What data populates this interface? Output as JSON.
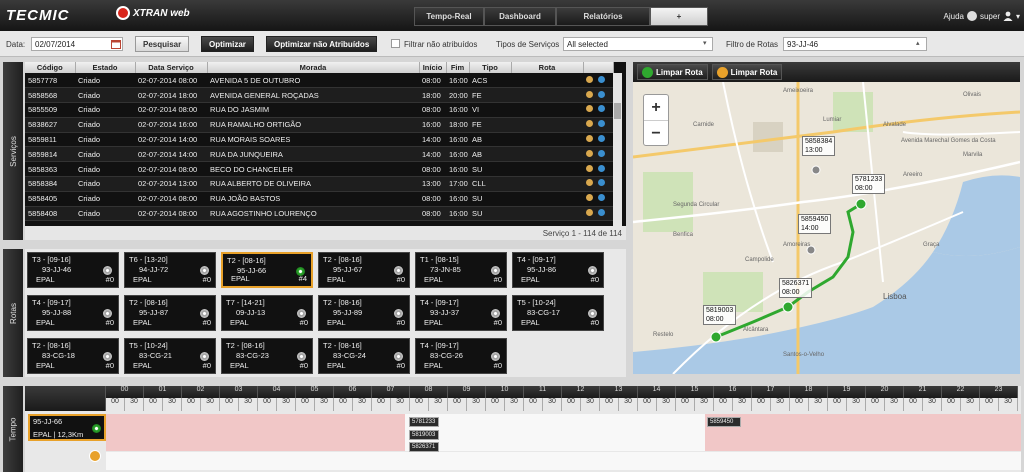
{
  "header": {
    "logo_primary": "TECMIC",
    "logo_secondary": "XTRAN web",
    "tabs": [
      "Tempo-Real",
      "Dashboard",
      "Relatórios",
      "+"
    ],
    "active_tab": 3,
    "help": "Ajuda",
    "user": "super"
  },
  "filters": {
    "date_label": "Data:",
    "date_value": "02/07/2014",
    "search_btn": "Pesquisar",
    "optimize_btn": "Optimizar",
    "optimize_unassigned_btn": "Optimizar não Atribuídos",
    "filter_unassigned_label": "Filtrar não atribuídos",
    "service_types_label": "Tipos de Serviços",
    "service_types_value": "All selected",
    "route_filter_label": "Filtro de Rotas",
    "route_filter_value": "93-JJ-46"
  },
  "services": {
    "panel_label": "Serviços",
    "columns": [
      "Código",
      "Estado",
      "Data Serviço",
      "Morada",
      "Início",
      "Fim",
      "Tipo",
      "Rota"
    ],
    "rows": [
      [
        "5857778",
        "Criado",
        "02-07-2014 08:00",
        "AVENIDA 5 DE OUTUBRO",
        "08:00",
        "16:00",
        "ACS"
      ],
      [
        "5858568",
        "Criado",
        "02-07-2014 18:00",
        "AVENIDA GENERAL ROÇADAS",
        "18:00",
        "20:00",
        "FE"
      ],
      [
        "5855509",
        "Criado",
        "02-07-2014 08:00",
        "RUA DO JASMIM",
        "08:00",
        "16:00",
        "VI"
      ],
      [
        "5838627",
        "Criado",
        "02-07-2014 16:00",
        "RUA RAMALHO ORTIGÃO",
        "16:00",
        "18:00",
        "FE"
      ],
      [
        "5859811",
        "Criado",
        "02-07-2014 14:00",
        "RUA MORAIS SOARES",
        "14:00",
        "16:00",
        "AB"
      ],
      [
        "5859814",
        "Criado",
        "02-07-2014 14:00",
        "RUA DA JUNQUEIRA",
        "14:00",
        "16:00",
        "AB"
      ],
      [
        "5858363",
        "Criado",
        "02-07-2014 08:00",
        "BECO DO CHANCELER",
        "08:00",
        "16:00",
        "SU"
      ],
      [
        "5858384",
        "Criado",
        "02-07-2014 13:00",
        "RUA ALBERTO DE OLIVEIRA",
        "13:00",
        "17:00",
        "CLL"
      ],
      [
        "5858405",
        "Criado",
        "02-07-2014 08:00",
        "RUA JOÃO BASTOS",
        "08:00",
        "16:00",
        "SU"
      ],
      [
        "5858408",
        "Criado",
        "02-07-2014 08:00",
        "RUA AGOSTINHO LOURENÇO",
        "08:00",
        "16:00",
        "SU"
      ]
    ],
    "footer": "Serviço 1 - 114 de 114"
  },
  "routes": {
    "panel_label": "Rotas",
    "cards": [
      {
        "title": "T3 - [09-16]",
        "plate": "93-JJ-46",
        "entity": "EPAL",
        "count": "#0"
      },
      {
        "title": "T6 - [13-20]",
        "plate": "94-JJ-72",
        "entity": "EPAL",
        "count": "#0"
      },
      {
        "title": "T2 - [08-16]",
        "plate": "95-JJ-66",
        "entity": "EPAL",
        "count": "#4"
      },
      {
        "title": "T2 - [08-16]",
        "plate": "95-JJ-67",
        "entity": "EPAL",
        "count": "#0"
      },
      {
        "title": "T1 - [08-15]",
        "plate": "73-JN-85",
        "entity": "EPAL",
        "count": "#0"
      },
      {
        "title": "T4 - [09-17]",
        "plate": "95-JJ-86",
        "entity": "EPAL",
        "count": "#0"
      },
      {
        "title": "T4 - [09-17]",
        "plate": "95-JJ-88",
        "entity": "EPAL",
        "count": "#0"
      },
      {
        "title": "T2 - [08-16]",
        "plate": "95-JJ-87",
        "entity": "EPAL",
        "count": "#0"
      },
      {
        "title": "T7 - [14-21]",
        "plate": "09-JJ-13",
        "entity": "EPAL",
        "count": "#0"
      },
      {
        "title": "T2 - [08-16]",
        "plate": "95-JJ-89",
        "entity": "EPAL",
        "count": "#0"
      },
      {
        "title": "T4 - [09-17]",
        "plate": "93-JJ-37",
        "entity": "EPAL",
        "count": "#0"
      },
      {
        "title": "T5 - [10-24]",
        "plate": "83-CG-17",
        "entity": "EPAL",
        "count": "#0"
      },
      {
        "title": "T2 - [08-16]",
        "plate": "83-CG-18",
        "entity": "EPAL",
        "count": "#0"
      },
      {
        "title": "T5 - [10-24]",
        "plate": "83-CG-21",
        "entity": "EPAL",
        "count": "#0"
      },
      {
        "title": "T2 - [08-16]",
        "plate": "83-CG-23",
        "entity": "EPAL",
        "count": "#0"
      },
      {
        "title": "T2 - [08-16]",
        "plate": "83-CG-24",
        "entity": "EPAL",
        "count": "#0"
      },
      {
        "title": "T4 - [09-17]",
        "plate": "83-CG-26",
        "entity": "EPAL",
        "count": "#0"
      }
    ]
  },
  "map": {
    "clear_route_1": "Limpar Rota",
    "clear_route_2": "Limpar Rota",
    "zoom_in": "+",
    "zoom_out": "−",
    "markers": [
      {
        "id": "5858384",
        "time": "13:00"
      },
      {
        "id": "5781233",
        "time": "08:00"
      },
      {
        "id": "5859450",
        "time": "14:00"
      },
      {
        "id": "5826371",
        "time": "08:00"
      },
      {
        "id": "5819003",
        "time": "08:00"
      }
    ],
    "place_labels": [
      "Ameixoeira",
      "Lumiar",
      "Olivais",
      "Carnide",
      "Benfica",
      "Alvalade",
      "Areeiro",
      "Marvila",
      "Campolide",
      "Amoreiras",
      "Alcântara",
      "Santos-o-Velho",
      "Restelo",
      "Lisboa",
      "Graça",
      "Avenida Marechal Gomes da Costa",
      "Segunda Circular"
    ]
  },
  "tempo": {
    "panel_label": "Tempo",
    "hours": [
      "00",
      "01",
      "02",
      "03",
      "04",
      "05",
      "06",
      "07",
      "08",
      "09",
      "10",
      "11",
      "12",
      "13",
      "14",
      "15",
      "16",
      "17",
      "18",
      "19",
      "20",
      "21",
      "22",
      "23"
    ],
    "half": [
      "00",
      "30"
    ],
    "vehicle_plate": "95-JJ-66",
    "vehicle_info": "EPAL | 12,3Km",
    "blocks": [
      "5781233",
      "5819003",
      "5826371",
      "5859450"
    ]
  },
  "colors": {
    "accent_orange": "#e8a12a",
    "route_green": "#2fa82f",
    "lane_pink": "#f1c7c7"
  }
}
